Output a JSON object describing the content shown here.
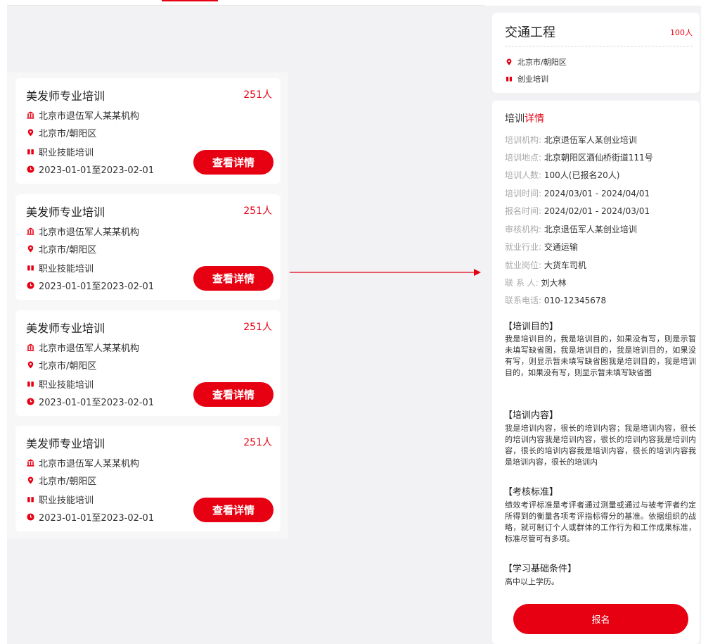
{
  "cards": [
    {
      "title": "美发师专业培训",
      "count": "251人",
      "org": "北京市退伍军人某某机构",
      "location": "北京市/朝阳区",
      "category": "职业技能培训",
      "date_range": "2023-01-01至2023-02-01",
      "button": "查看详情"
    },
    {
      "title": "美发师专业培训",
      "count": "251人",
      "org": "北京市退伍军人某某机构",
      "location": "北京市/朝阳区",
      "category": "职业技能培训",
      "date_range": "2023-01-01至2023-02-01",
      "button": "查看详情"
    },
    {
      "title": "美发师专业培训",
      "count": "251人",
      "org": "北京市退伍军人某某机构",
      "location": "北京市/朝阳区",
      "category": "职业技能培训",
      "date_range": "2023-01-01至2023-02-01",
      "button": "查看详情"
    },
    {
      "title": "美发师专业培训",
      "count": "251人",
      "org": "北京市退伍军人某某机构",
      "location": "北京市/朝阳区",
      "category": "职业技能培训",
      "date_range": "2023-01-01至2023-02-01",
      "button": "查看详情"
    }
  ],
  "summary": {
    "title": "交通工程",
    "count": "100人",
    "location": "北京市/朝阳区",
    "category": "创业培训"
  },
  "detail": {
    "heading_plain": "培训",
    "heading_accent": "详情",
    "fields": [
      {
        "label": "培训机构:",
        "value": "北京退伍军人某创业培训"
      },
      {
        "label": "培训地点:",
        "value": "北京朝阳区酒仙桥街道111号"
      },
      {
        "label": "培训人数:",
        "value": "100人(已报名20人)"
      },
      {
        "label": "培训时间:",
        "value": "2024/03/01 - 2024/04/01"
      },
      {
        "label": "报名时间:",
        "value": "2024/02/01 - 2024/03/01"
      },
      {
        "label": "审核机构:",
        "value": "北京退伍军人某创业培训"
      },
      {
        "label": "就业行业:",
        "value": "交通运输"
      },
      {
        "label": "就业岗位:",
        "value": "大货车司机"
      },
      {
        "label": "联 系 人:",
        "value": "刘大林"
      },
      {
        "label": "联系电话:",
        "value": "010-12345678"
      }
    ],
    "sections": [
      {
        "title": "【培训目的】",
        "body": "我是培训目的，我是培训目的，如果没有写，则是示暂未填写缺省图，我是培训目的，我是培训目的，如果没有写，则显示暂未填写缺省图我是培训目的，我是培训目的，如果没有写，则显示暂未填写缺省图"
      },
      {
        "title": "【培训内容】",
        "body": "我是培训内容，很长的培训内容；我是培训内容，很长的培训内容我是培训内容，很长的培训内容我是培训内容，很长的培训内容我是培训内容，很长的培训内容我是培训内容，很长的培训内"
      },
      {
        "title": "【考核标准】",
        "body": "绩效考评标准是考评者通过测量或通过与被考评者约定所得到的衡量各项考评指标得分的基准。依据组织的战略，就可制订个人或群体的工作行为和工作成果标准，标准尽管可有多项。"
      },
      {
        "title": "【学习基础条件】",
        "body": "高中以上学历。"
      }
    ],
    "signup_button": "报名"
  },
  "colors": {
    "accent": "#e60012",
    "panel_bg": "#f2f2f4"
  },
  "icons": [
    "institution-icon",
    "location-pin-icon",
    "category-tag-icon",
    "clock-icon",
    "arrow-right-icon"
  ]
}
